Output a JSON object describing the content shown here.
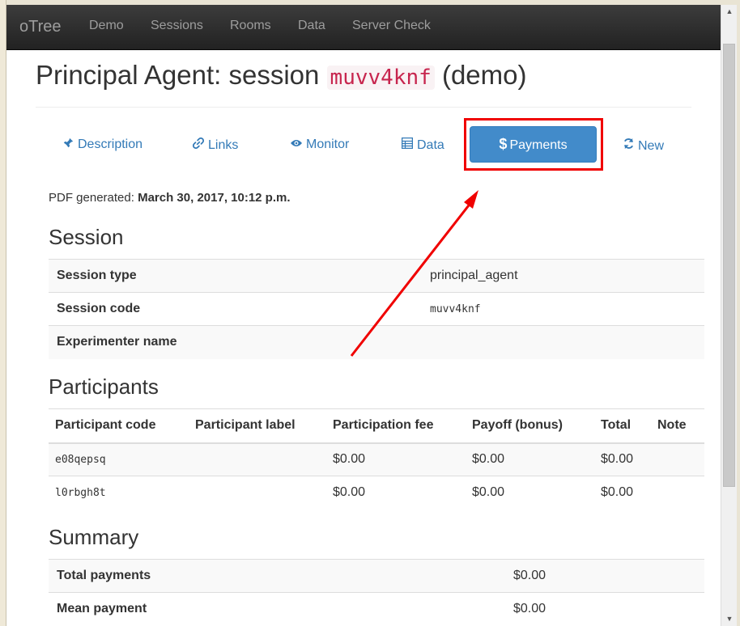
{
  "navbar": {
    "brand": "oTree",
    "links": [
      "Demo",
      "Sessions",
      "Rooms",
      "Data",
      "Server Check"
    ]
  },
  "page": {
    "title_prefix": "Principal Agent: session",
    "session_code": "muvv4knf",
    "title_suffix": "(demo)"
  },
  "tabs": [
    {
      "label": "Description",
      "icon": "pushpin-icon"
    },
    {
      "label": "Links",
      "icon": "link-icon"
    },
    {
      "label": "Monitor",
      "icon": "eye-icon"
    },
    {
      "label": "Data",
      "icon": "table-icon"
    },
    {
      "label": "Payments",
      "icon": "dollar-icon",
      "active": true
    },
    {
      "label": "New",
      "icon": "refresh-icon"
    }
  ],
  "pdf": {
    "label": "PDF generated:",
    "value": "March 30, 2017, 10:12 p.m."
  },
  "session": {
    "heading": "Session",
    "rows": [
      {
        "label": "Session type",
        "value": "principal_agent"
      },
      {
        "label": "Session code",
        "value": "muvv4knf"
      },
      {
        "label": "Experimenter name",
        "value": ""
      }
    ]
  },
  "participants": {
    "heading": "Participants",
    "columns": [
      "Participant code",
      "Participant label",
      "Participation fee",
      "Payoff (bonus)",
      "Total",
      "Note"
    ],
    "rows": [
      {
        "code": "e08qepsq",
        "label": "",
        "fee": "$0.00",
        "payoff": "$0.00",
        "total": "$0.00",
        "note": ""
      },
      {
        "code": "l0rbgh8t",
        "label": "",
        "fee": "$0.00",
        "payoff": "$0.00",
        "total": "$0.00",
        "note": ""
      }
    ]
  },
  "summary": {
    "heading": "Summary",
    "rows": [
      {
        "label": "Total payments",
        "value": "$0.00"
      },
      {
        "label": "Mean payment",
        "value": "$0.00"
      }
    ]
  },
  "colors": {
    "annotation": "#f00000",
    "primary": "#428bca",
    "link": "#337ab7"
  }
}
